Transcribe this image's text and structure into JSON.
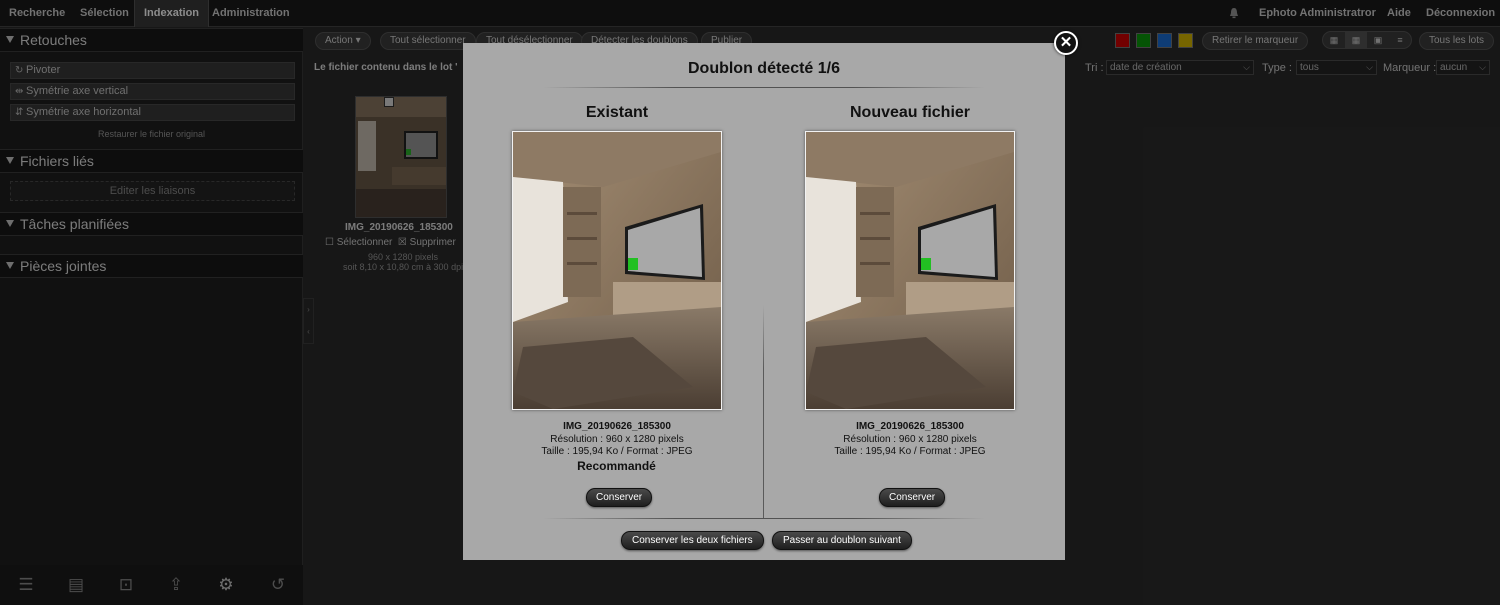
{
  "nav": {
    "tabs": [
      "Recherche",
      "Sélection",
      "Indexation",
      "Administration"
    ],
    "user": "Ephoto Administratror",
    "help": "Aide",
    "logout": "Déconnexion",
    "bell_icon": "bell-icon"
  },
  "sidebar": {
    "retouches": {
      "title": "Retouches",
      "pivoter": "Pivoter",
      "sym_v": "Symétrie axe vertical",
      "sym_h": "Symétrie axe horizontal",
      "restore": "Restaurer le fichier original"
    },
    "fichiers_lies": {
      "title": "Fichiers liés",
      "edit_links": "Editer les liaisons"
    },
    "taches": {
      "title": "Tâches planifiées"
    },
    "pieces": {
      "title": "Pièces jointes"
    },
    "tools": [
      "list-icon",
      "cards-icon",
      "person-icon",
      "upload-icon",
      "gear-icon",
      "history-icon"
    ]
  },
  "toolbar": {
    "action": "Action",
    "select_all": "Tout sélectionner",
    "deselect_all": "Tout désélectionner",
    "detect_dups": "Détecter les doublons",
    "publish": "Publier",
    "remove_marker": "Retirer le marqueur",
    "all_lots": "Tous les lots",
    "swatch_colors": [
      "#d00000",
      "#0a9a0a",
      "#1a6ed6",
      "#d8b800"
    ]
  },
  "filters": {
    "lot_caption": "Le fichier contenu dans le lot '",
    "sort_label": "Tri :",
    "sort_value": "date de création",
    "type_label": "Type :",
    "type_value": "tous",
    "marker_label": "Marqueur :",
    "marker_value": "aucun"
  },
  "thumbnail": {
    "filename": "IMG_20190626_185300",
    "select": "Sélectionner",
    "delete": "Supprimer",
    "pixels": "960 x 1280 pixels",
    "physical": "soit 8,10 x 10,80 cm à 300 dpi"
  },
  "modal": {
    "title": "Doublon détecté 1/6",
    "existing": {
      "heading": "Existant",
      "filename": "IMG_20190626_185300",
      "resolution": "Résolution : 960 x 1280 pixels",
      "size": "Taille : 195,94 Ko / Format : JPEG",
      "recommended": "Recommandé",
      "keep": "Conserver"
    },
    "new_file": {
      "heading": "Nouveau fichier",
      "filename": "IMG_20190626_185300",
      "resolution": "Résolution : 960 x 1280 pixels",
      "size": "Taille : 195,94 Ko / Format : JPEG",
      "keep": "Conserver"
    },
    "keep_both": "Conserver les deux fichiers",
    "next_dup": "Passer au doublon suivant",
    "close_icon": "close-icon"
  }
}
